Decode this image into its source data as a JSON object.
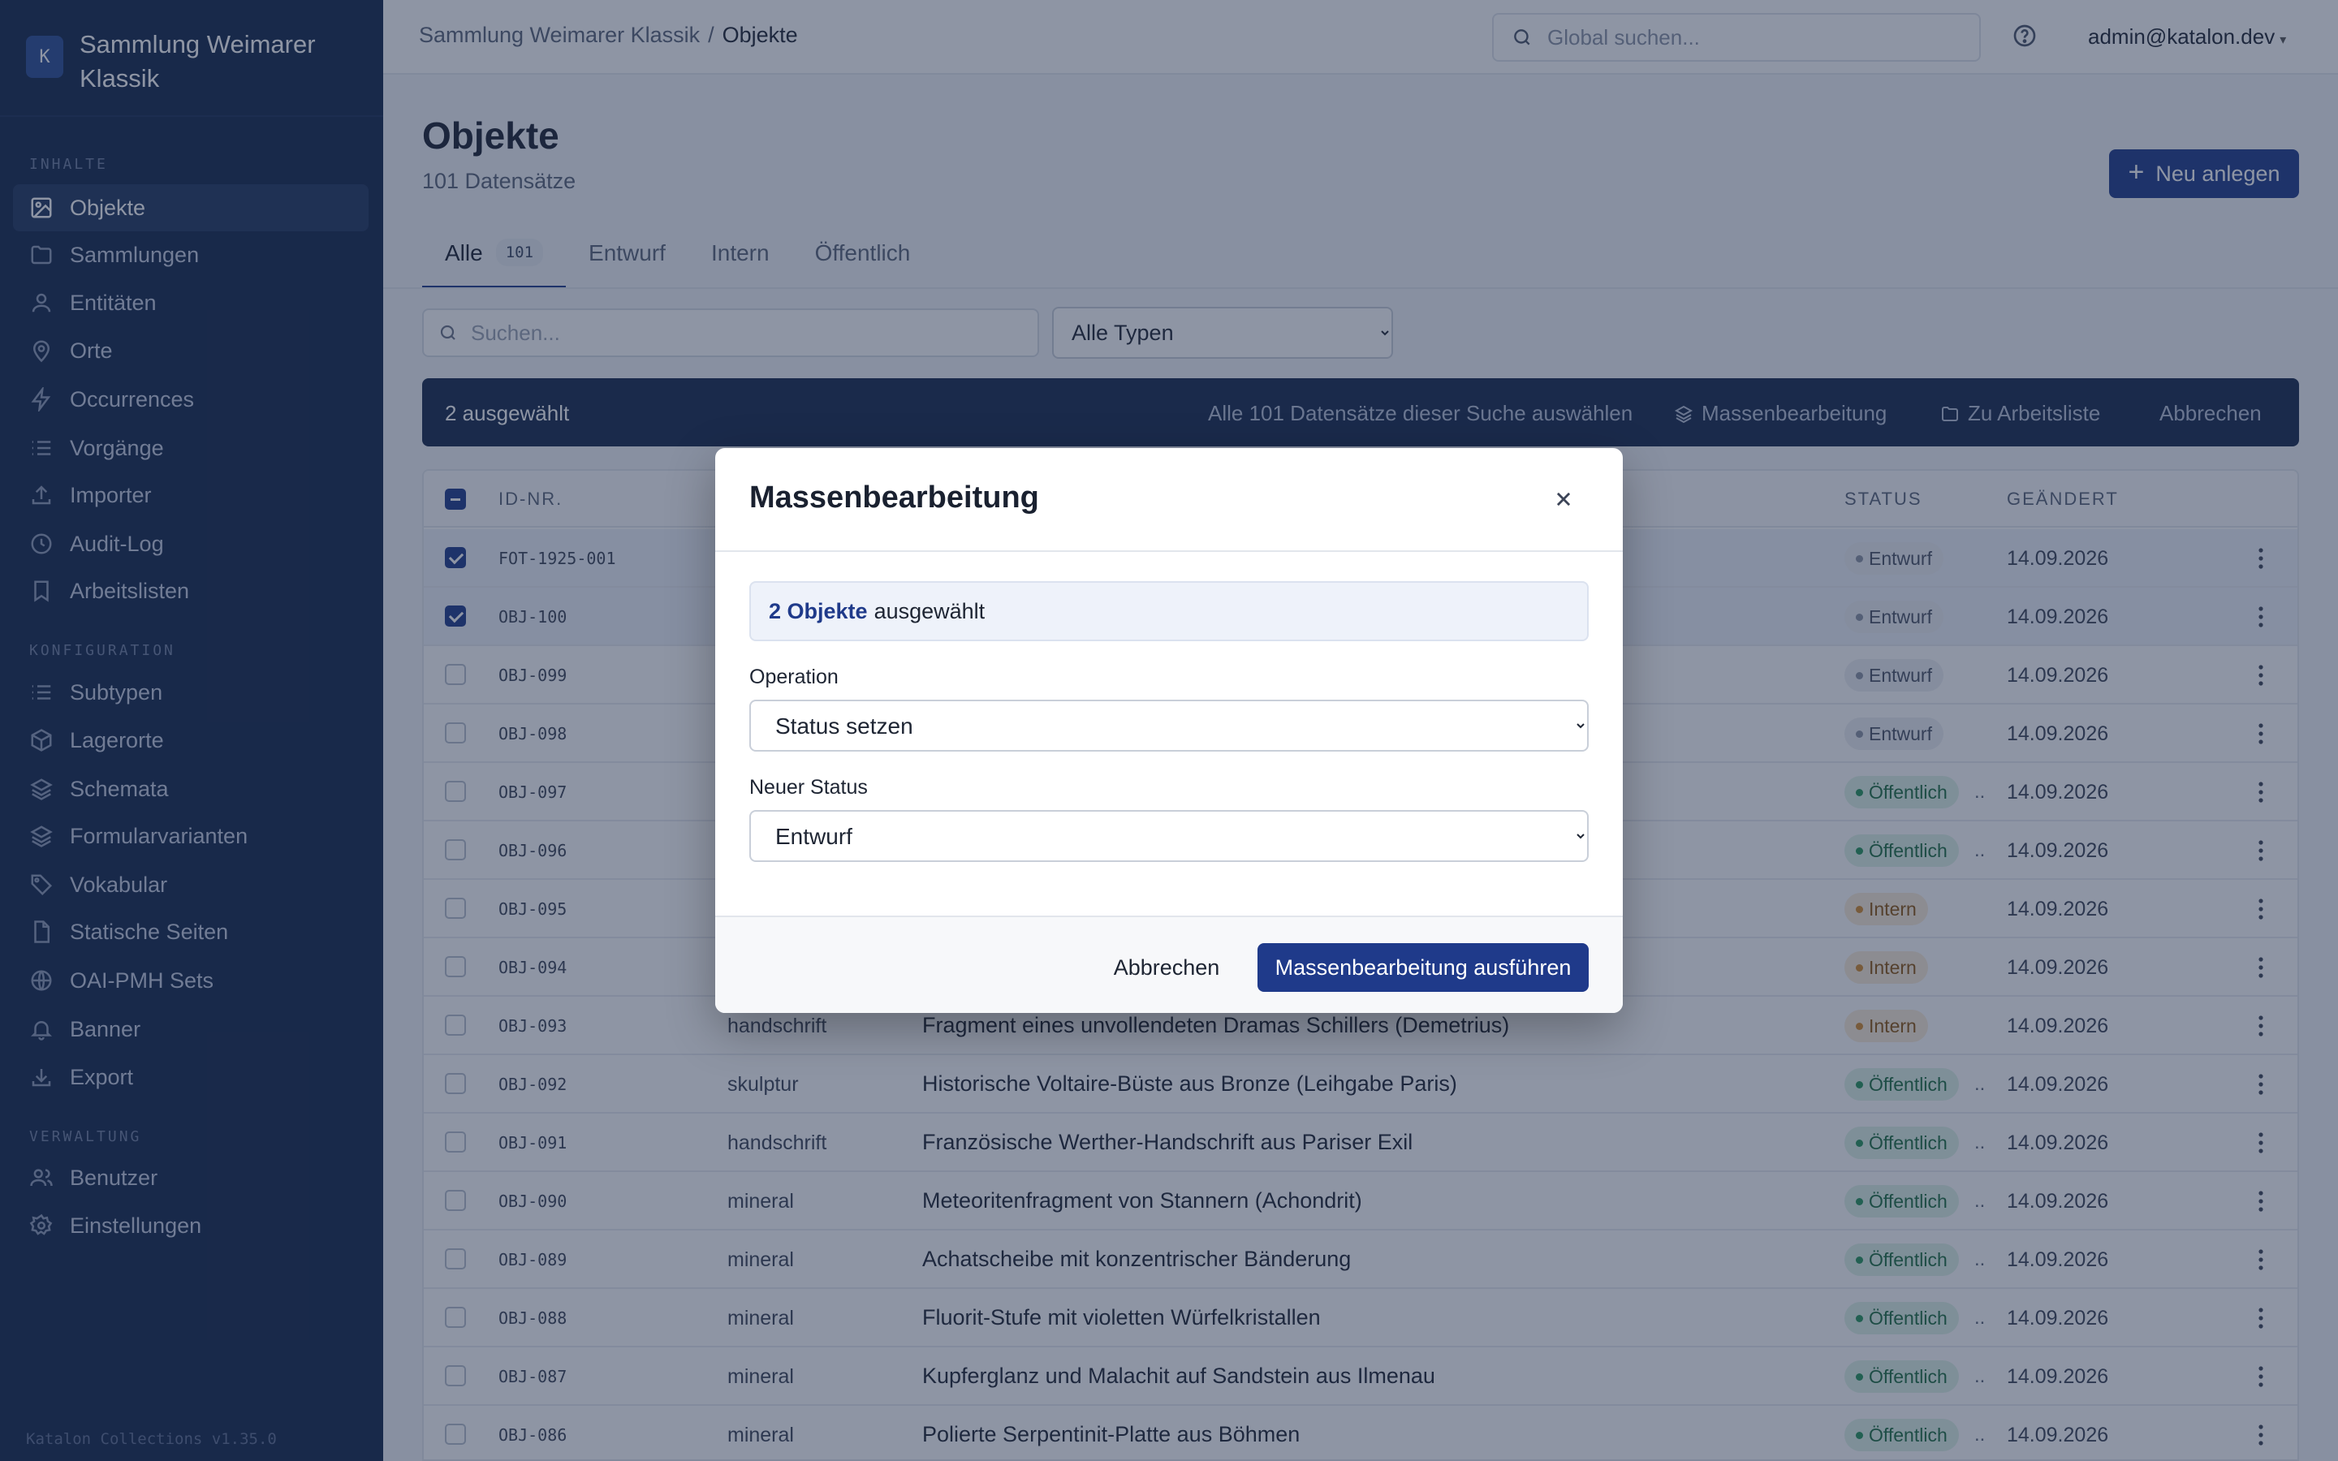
{
  "brand": {
    "logo": "K",
    "title": "Sammlung Weimarer Klassik"
  },
  "sidebar": {
    "sections": [
      "INHALTE",
      "KONFIGURATION",
      "VERWALTUNG"
    ],
    "items": [
      {
        "label": "Objekte",
        "icon": "image-icon"
      },
      {
        "label": "Sammlungen",
        "icon": "folder-icon"
      },
      {
        "label": "Entitäten",
        "icon": "user-icon"
      },
      {
        "label": "Orte",
        "icon": "map-pin-icon"
      },
      {
        "label": "Occurrences",
        "icon": "lightning-icon"
      },
      {
        "label": "Vorgänge",
        "icon": "list-icon"
      },
      {
        "label": "Importer",
        "icon": "upload-icon"
      },
      {
        "label": "Audit-Log",
        "icon": "clock-icon"
      },
      {
        "label": "Arbeitslisten",
        "icon": "bookmark-icon"
      },
      {
        "label": "Subtypen",
        "icon": "list-icon"
      },
      {
        "label": "Lagerorte",
        "icon": "box-icon"
      },
      {
        "label": "Schemata",
        "icon": "layers-icon"
      },
      {
        "label": "Formularvarianten",
        "icon": "layers-icon"
      },
      {
        "label": "Vokabular",
        "icon": "tag-icon"
      },
      {
        "label": "Statische Seiten",
        "icon": "file-icon"
      },
      {
        "label": "OAI-PMH Sets",
        "icon": "globe-icon"
      },
      {
        "label": "Banner",
        "icon": "bell-icon"
      },
      {
        "label": "Export",
        "icon": "download-icon"
      },
      {
        "label": "Benutzer",
        "icon": "users-icon"
      },
      {
        "label": "Einstellungen",
        "icon": "gear-icon"
      }
    ],
    "version": "Katalon Collections v1.35.0"
  },
  "topbar": {
    "breadcrumb_parent": "Sammlung Weimarer Klassik",
    "breadcrumb_sep": "/",
    "breadcrumb_current": "Objekte",
    "search_placeholder": "Global suchen...",
    "user": "admin@katalon.dev",
    "user_caret": "▾"
  },
  "page": {
    "title": "Objekte",
    "count": "101 Datensätze",
    "new_button": "Neu anlegen",
    "new_button_plus": "+"
  },
  "tabs": [
    {
      "label": "Alle",
      "count": "101"
    },
    {
      "label": "Entwurf"
    },
    {
      "label": "Intern"
    },
    {
      "label": "Öffentlich"
    }
  ],
  "filters": {
    "search_placeholder": "Suchen...",
    "type_selected": "Alle Typen"
  },
  "selection_bar": {
    "count": "2 ausgewählt",
    "select_all": "Alle 101 Datensätze dieser Suche auswählen",
    "bulk_edit": "Massenbearbeitung",
    "to_worklist": "Zu Arbeitsliste",
    "cancel": "Abbrechen"
  },
  "table": {
    "headers": {
      "id": "ID-NR.",
      "status": "STATUS",
      "changed": "GEÄNDERT"
    },
    "rows": [
      {
        "id": "FOT-1925-001",
        "type": "",
        "title": "",
        "status": "Entwurf",
        "status_class": "entwurf",
        "date": "14.09.2026",
        "selected": true
      },
      {
        "id": "OBJ-100",
        "type": "",
        "title": "",
        "status": "Entwurf",
        "status_class": "entwurf",
        "date": "14.09.2026",
        "selected": true
      },
      {
        "id": "OBJ-099",
        "type": "",
        "title": "",
        "status": "Entwurf",
        "status_class": "entwurf",
        "date": "14.09.2026",
        "selected": false
      },
      {
        "id": "OBJ-098",
        "type": "",
        "title": "",
        "status": "Entwurf",
        "status_class": "entwurf",
        "date": "14.09.2026",
        "selected": false
      },
      {
        "id": "OBJ-097",
        "type": "",
        "title": "",
        "status": "Öffentlich",
        "status_class": "oeffentlich",
        "date": "14.09.2026",
        "selected": false
      },
      {
        "id": "OBJ-096",
        "type": "",
        "title": "",
        "status": "Öffentlich",
        "status_class": "oeffentlich",
        "date": "14.09.2026",
        "selected": false
      },
      {
        "id": "OBJ-095",
        "type": "",
        "title": "",
        "status": "Intern",
        "status_class": "intern",
        "date": "14.09.2026",
        "selected": false
      },
      {
        "id": "OBJ-094",
        "type": "",
        "title": "",
        "status": "Intern",
        "status_class": "intern",
        "date": "14.09.2026",
        "selected": false
      },
      {
        "id": "OBJ-093",
        "type": "handschrift",
        "title": "Fragment eines unvollendeten Dramas Schillers (Demetrius)",
        "status": "Intern",
        "status_class": "intern",
        "date": "14.09.2026",
        "selected": false
      },
      {
        "id": "OBJ-092",
        "type": "skulptur",
        "title": "Historische Voltaire-Büste aus Bronze (Leihgabe Paris)",
        "status": "Öffentlich",
        "status_class": "oeffentlich",
        "date": "14.09.2026",
        "selected": false
      },
      {
        "id": "OBJ-091",
        "type": "handschrift",
        "title": "Französische Werther-Handschrift aus Pariser Exil",
        "status": "Öffentlich",
        "status_class": "oeffentlich",
        "date": "14.09.2026",
        "selected": false
      },
      {
        "id": "OBJ-090",
        "type": "mineral",
        "title": "Meteoritenfragment von Stannern (Achondrit)",
        "status": "Öffentlich",
        "status_class": "oeffentlich",
        "date": "14.09.2026",
        "selected": false
      },
      {
        "id": "OBJ-089",
        "type": "mineral",
        "title": "Achatscheibe mit konzentrischer Bänderung",
        "status": "Öffentlich",
        "status_class": "oeffentlich",
        "date": "14.09.2026",
        "selected": false
      },
      {
        "id": "OBJ-088",
        "type": "mineral",
        "title": "Fluorit-Stufe mit violetten Würfelkristallen",
        "status": "Öffentlich",
        "status_class": "oeffentlich",
        "date": "14.09.2026",
        "selected": false
      },
      {
        "id": "OBJ-087",
        "type": "mineral",
        "title": "Kupferglanz und Malachit auf Sandstein aus Ilmenau",
        "status": "Öffentlich",
        "status_class": "oeffentlich",
        "date": "14.09.2026",
        "selected": false
      },
      {
        "id": "OBJ-086",
        "type": "mineral",
        "title": "Polierte Serpentinit-Platte aus Böhmen",
        "status": "Öffentlich",
        "status_class": "oeffentlich",
        "date": "14.09.2026",
        "selected": false
      }
    ],
    "truncation": ".."
  },
  "modal": {
    "title": "Massenbearbeitung",
    "info_count": "2 Objekte",
    "info_text": "ausgewählt",
    "operation_label": "Operation",
    "operation_value": "Status setzen",
    "status_label": "Neuer Status",
    "status_value": "Entwurf",
    "cancel": "Abbrechen",
    "submit": "Massenbearbeitung ausführen"
  },
  "colors": {
    "sidebar_bg": "#13264a",
    "primary": "#1f3a8a",
    "selection_bar": "#16284c"
  }
}
